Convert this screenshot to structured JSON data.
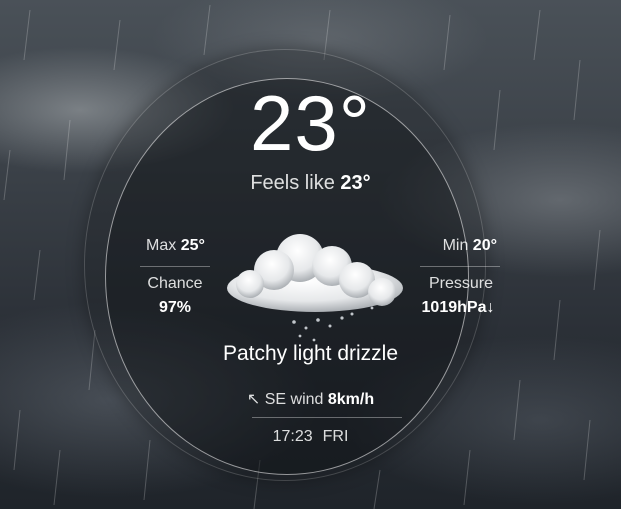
{
  "weather": {
    "temperature": "23°",
    "feels_like_label": "Feels like",
    "feels_like_value": "23°",
    "max_label": "Max",
    "max_value": "25°",
    "min_label": "Min",
    "min_value": "20°",
    "chance_label": "Chance",
    "chance_value": "97%",
    "pressure_label": "Pressure",
    "pressure_value": "1019hPa↓",
    "condition": "Patchy light drizzle",
    "wind_arrow": "↖",
    "wind_label": "SE wind",
    "wind_value": "8km/h",
    "time": "17:23",
    "day": "FRI",
    "condition_icon": "cloud-drizzle-icon"
  },
  "colors": {
    "text": "#ffffff",
    "ring": "#ffffff",
    "sky": "#2b3037"
  }
}
